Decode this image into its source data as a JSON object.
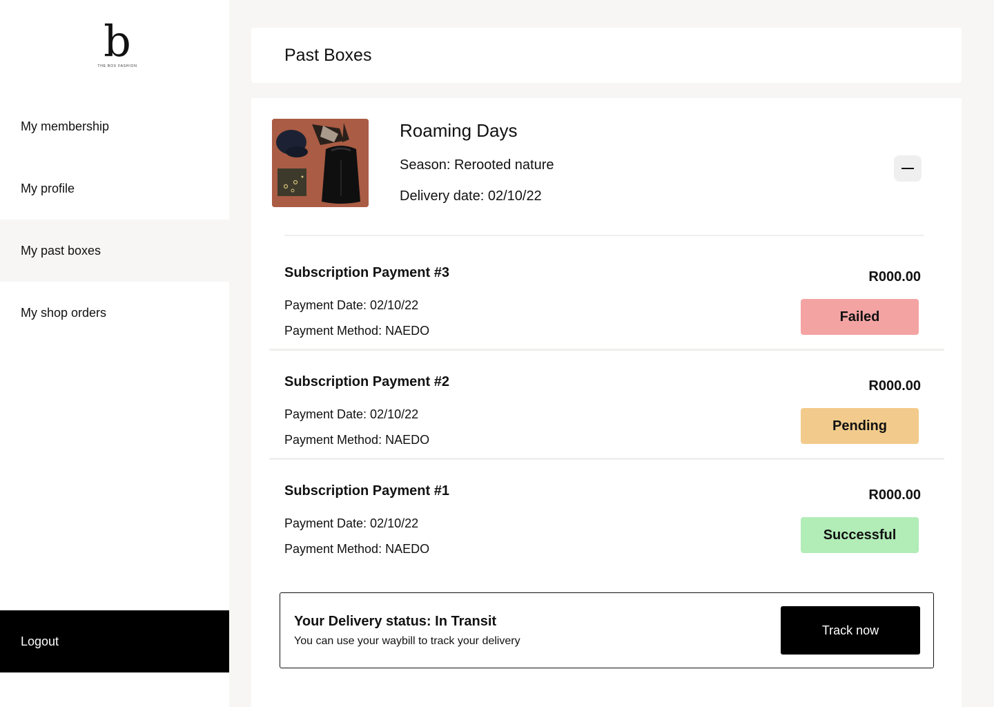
{
  "brand": {
    "logo_mark": "b",
    "logo_text": "THE BOX FASHION"
  },
  "sidebar": {
    "items": [
      {
        "label": "My membership",
        "active": false
      },
      {
        "label": "My profile",
        "active": false
      },
      {
        "label": "My past boxes",
        "active": true
      },
      {
        "label": "My shop orders",
        "active": false
      }
    ],
    "logout_label": "Logout"
  },
  "header": {
    "title": "Past Boxes"
  },
  "box": {
    "title": "Roaming Days",
    "season": "Season: Rerooted nature",
    "delivery_date": "Delivery date: 02/10/22",
    "collapse_icon": "minus-icon"
  },
  "payments": [
    {
      "title": "Subscription Payment #3",
      "date": "Payment Date: 02/10/22",
      "method": "Payment Method: NAEDO",
      "amount": "R000.00",
      "status": "Failed",
      "status_color": "#f4a3a3"
    },
    {
      "title": "Subscription Payment #2",
      "date": "Payment Date: 02/10/22",
      "method": "Payment Method: NAEDO",
      "amount": "R000.00",
      "status": "Pending",
      "status_color": "#f2cb8c"
    },
    {
      "title": "Subscription Payment #1",
      "date": "Payment Date: 02/10/22",
      "method": "Payment Method: NAEDO",
      "amount": "R000.00",
      "status": "Successful",
      "status_color": "#b2ecb7"
    }
  ],
  "delivery": {
    "title": "Your Delivery status: In Transit",
    "subtitle": "You can use your waybill to track your delivery",
    "track_label": "Track now"
  },
  "colors": {
    "page_bg": "#f7f6f4",
    "card_bg": "#ffffff",
    "active_nav_bg": "#f7f6f4",
    "logout_bg": "#000000"
  }
}
